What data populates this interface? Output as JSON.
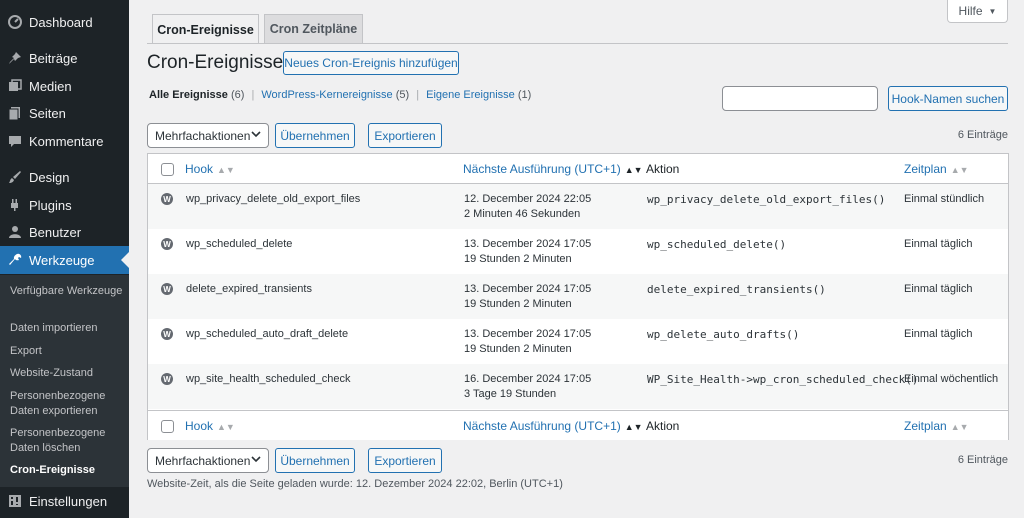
{
  "sidebar": {
    "items": [
      {
        "label": "Dashboard",
        "icon": "dashboard-icon"
      },
      {
        "label": "Beiträge",
        "icon": "pin-icon"
      },
      {
        "label": "Medien",
        "icon": "media-icon"
      },
      {
        "label": "Seiten",
        "icon": "pages-icon"
      },
      {
        "label": "Kommentare",
        "icon": "comment-icon"
      },
      {
        "label": "Design",
        "icon": "brush-icon"
      },
      {
        "label": "Plugins",
        "icon": "plugin-icon"
      },
      {
        "label": "Benutzer",
        "icon": "user-icon"
      },
      {
        "label": "Werkzeuge",
        "icon": "wrench-icon"
      },
      {
        "label": "Einstellungen",
        "icon": "settings-icon"
      }
    ],
    "submenu": [
      "Verfügbare Werkzeuge",
      "Daten importieren",
      "Export",
      "Website-Zustand",
      "Personenbezogene Daten exportieren",
      "Personenbezogene Daten löschen",
      "Cron-Ereignisse"
    ]
  },
  "tabs": [
    "Cron-Ereignisse",
    "Cron Zeitpläne"
  ],
  "help": "Hilfe",
  "page_title": "Cron-Ereignisse",
  "add_new_label": "Neues Cron-Ereignis hinzufügen",
  "filters": {
    "all": "Alle Ereignisse",
    "all_count": "(6)",
    "core": "WordPress-Kernereignisse",
    "core_count": "(5)",
    "own": "Eigene Ereignisse",
    "own_count": "(1)"
  },
  "search_button": "Hook-Namen suchen",
  "bulk": {
    "select_value": "Mehrfachaktionen",
    "apply": "Übernehmen",
    "export": "Exportieren"
  },
  "item_count": "6 Einträge",
  "columns": {
    "hook": "Hook",
    "next_run": "Nächste Ausführung (UTC+1)",
    "action": "Aktion",
    "schedule": "Zeitplan"
  },
  "rows": [
    {
      "hook": "wp_privacy_delete_old_export_files",
      "date": "12. December 2024 22:05",
      "rel": "2 Minuten 46 Sekunden",
      "action": "wp_privacy_delete_old_export_files()",
      "schedule": "Einmal stündlich"
    },
    {
      "hook": "wp_scheduled_delete",
      "date": "13. December 2024 17:05",
      "rel": "19 Stunden 2 Minuten",
      "action": "wp_scheduled_delete()",
      "schedule": "Einmal täglich"
    },
    {
      "hook": "delete_expired_transients",
      "date": "13. December 2024 17:05",
      "rel": "19 Stunden 2 Minuten",
      "action": "delete_expired_transients()",
      "schedule": "Einmal täglich"
    },
    {
      "hook": "wp_scheduled_auto_draft_delete",
      "date": "13. December 2024 17:05",
      "rel": "19 Stunden 2 Minuten",
      "action": "wp_delete_auto_drafts()",
      "schedule": "Einmal täglich"
    },
    {
      "hook": "wp_site_health_scheduled_check",
      "date": "16. December 2024 17:05",
      "rel": "3 Tage 19 Stunden",
      "action": "WP_Site_Health->wp_cron_scheduled_check()",
      "schedule": "Einmal wöchentlich"
    }
  ],
  "footer_note": "Website-Zeit, als die Seite geladen wurde: 12. Dezember 2024 22:02, Berlin (UTC+1)",
  "colors": {
    "accent": "#2271b1",
    "sidebar_bg": "#1d2327",
    "submenu_bg": "#2c3338",
    "page_bg": "#f0f0f1"
  }
}
